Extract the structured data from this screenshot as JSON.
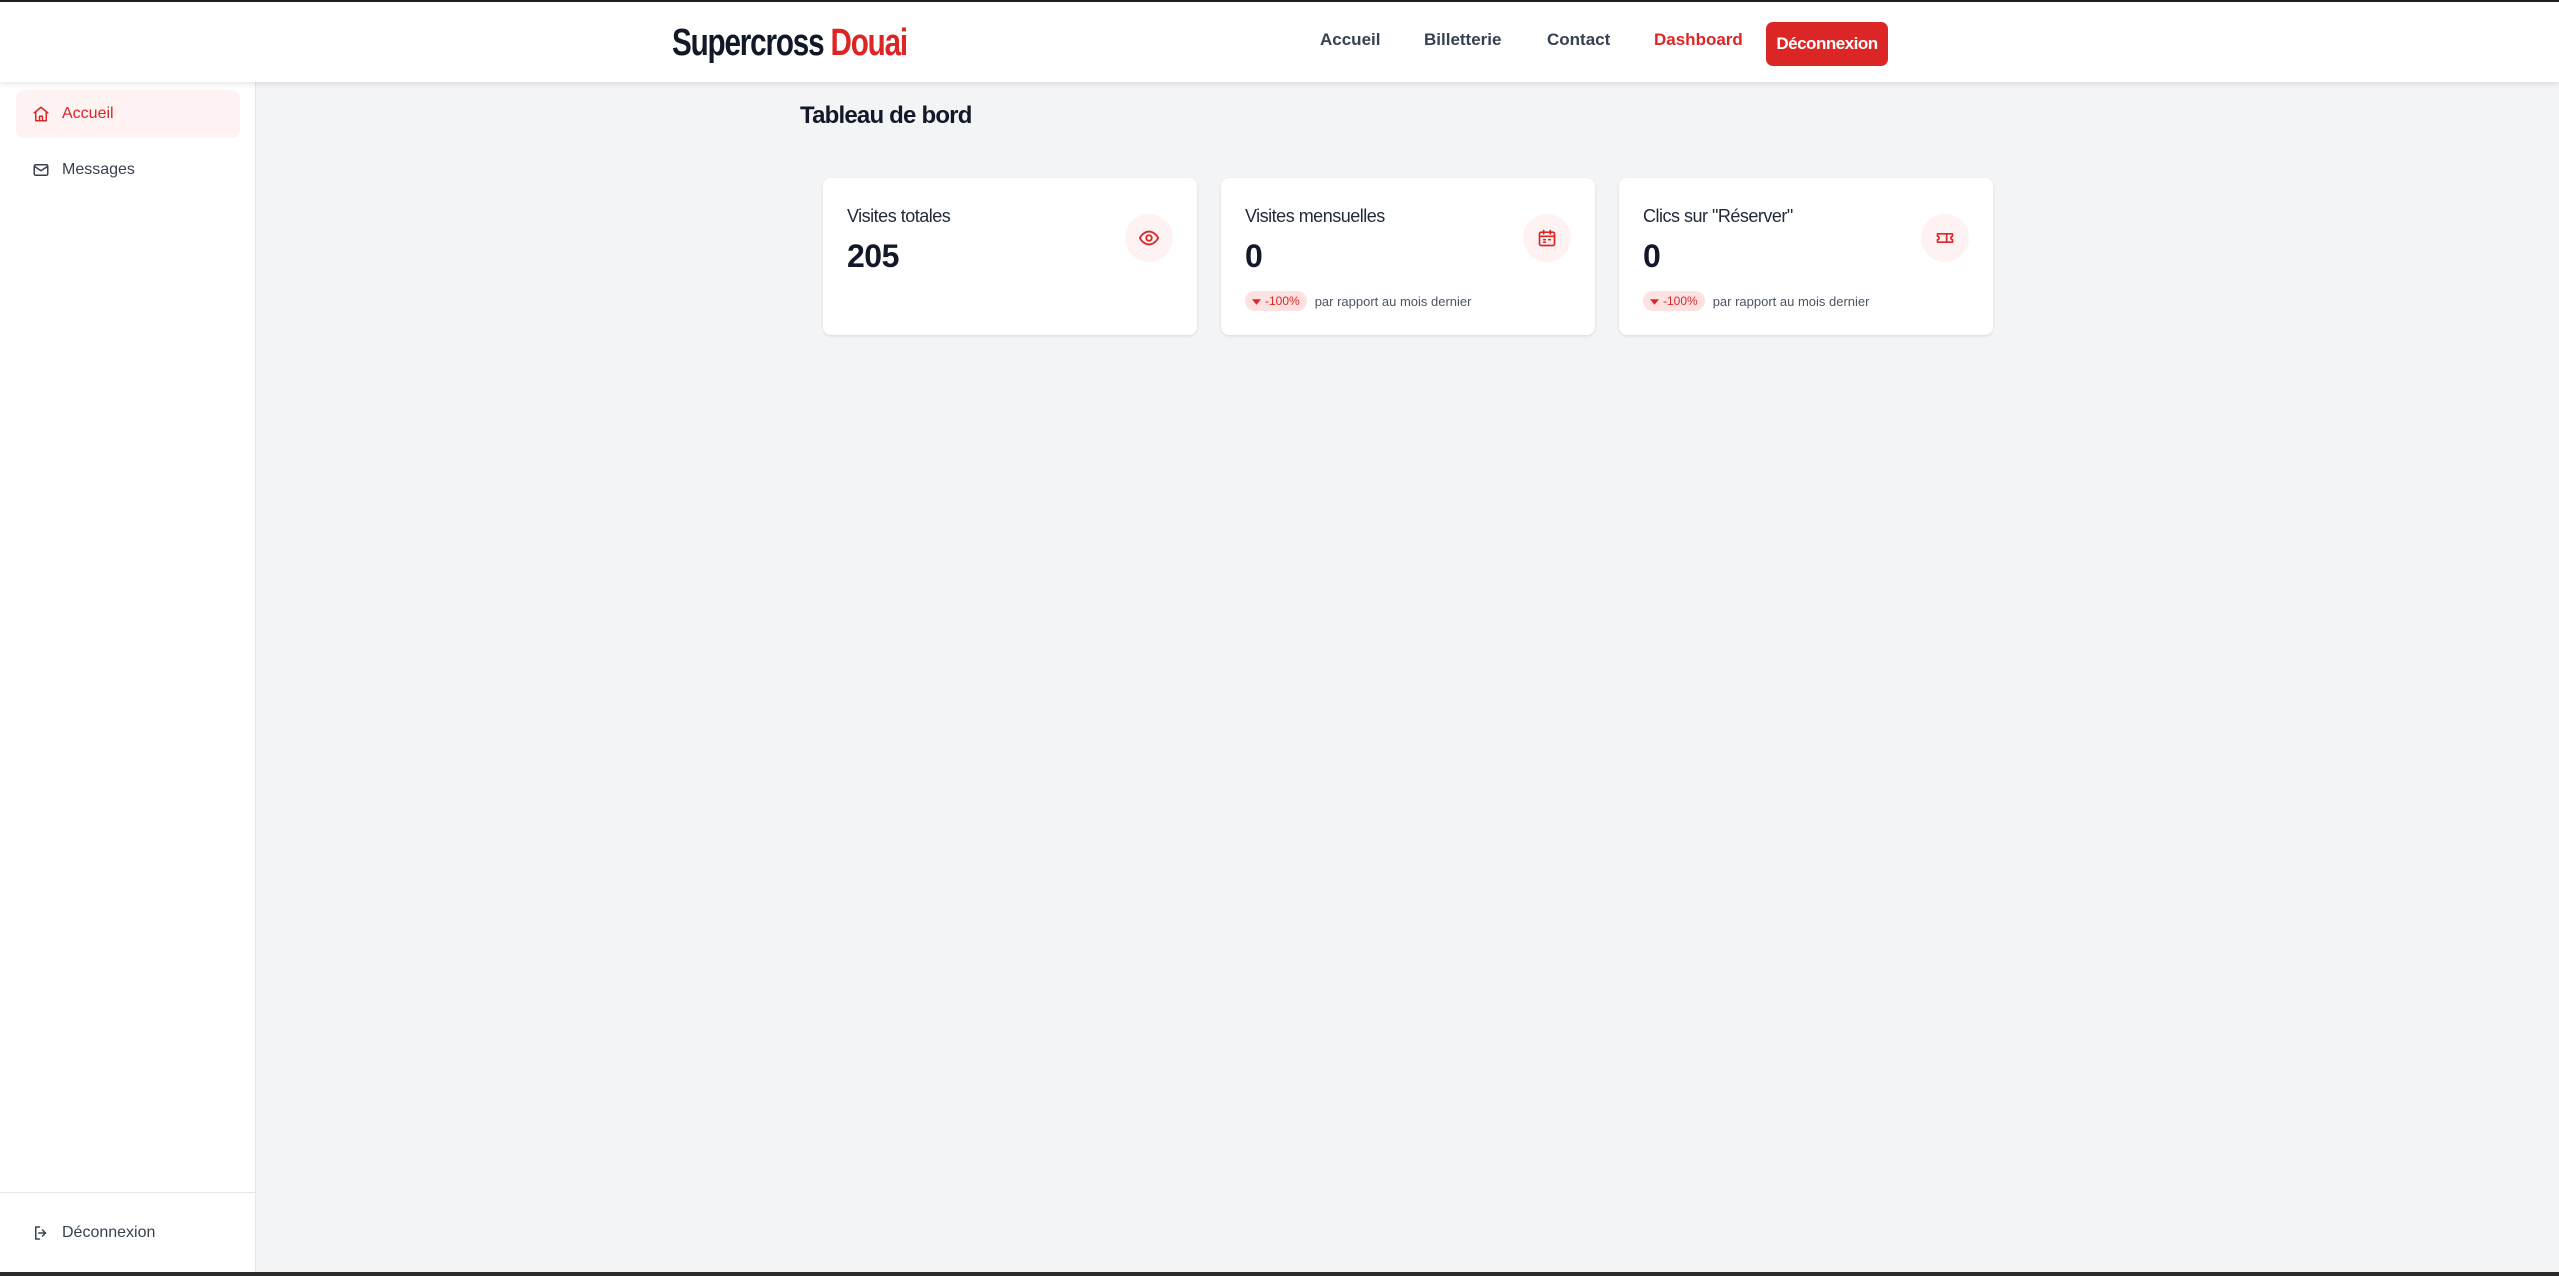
{
  "brand": {
    "part1": "Supercross",
    "part2": "Douai"
  },
  "nav": {
    "items": [
      {
        "label": "Accueil",
        "active": false
      },
      {
        "label": "Billetterie",
        "active": false
      },
      {
        "label": "Contact",
        "active": false
      },
      {
        "label": "Dashboard",
        "active": true
      }
    ],
    "logout_label": "Déconnexion"
  },
  "sidebar": {
    "items": [
      {
        "label": "Accueil",
        "icon": "home-icon",
        "active": true
      },
      {
        "label": "Messages",
        "icon": "mail-icon",
        "active": false
      }
    ],
    "logout": {
      "label": "Déconnexion",
      "icon": "logout-icon"
    }
  },
  "main": {
    "title": "Tableau de bord",
    "cards": [
      {
        "label": "Visites totales",
        "value": "205",
        "icon": "eye-icon"
      },
      {
        "label": "Visites mensuelles",
        "value": "0",
        "icon": "calendar-icon",
        "trend": {
          "value": "-100%",
          "text": "par rapport au mois dernier"
        }
      },
      {
        "label": "Clics sur \"Réserver\"",
        "value": "0",
        "icon": "ticket-icon",
        "trend": {
          "value": "-100%",
          "text": "par rapport au mois dernier"
        }
      }
    ]
  },
  "colors": {
    "accent": "#dc2626",
    "accent_light": "#fef2f2",
    "background": "#f3f4f6",
    "text": "#111827"
  }
}
